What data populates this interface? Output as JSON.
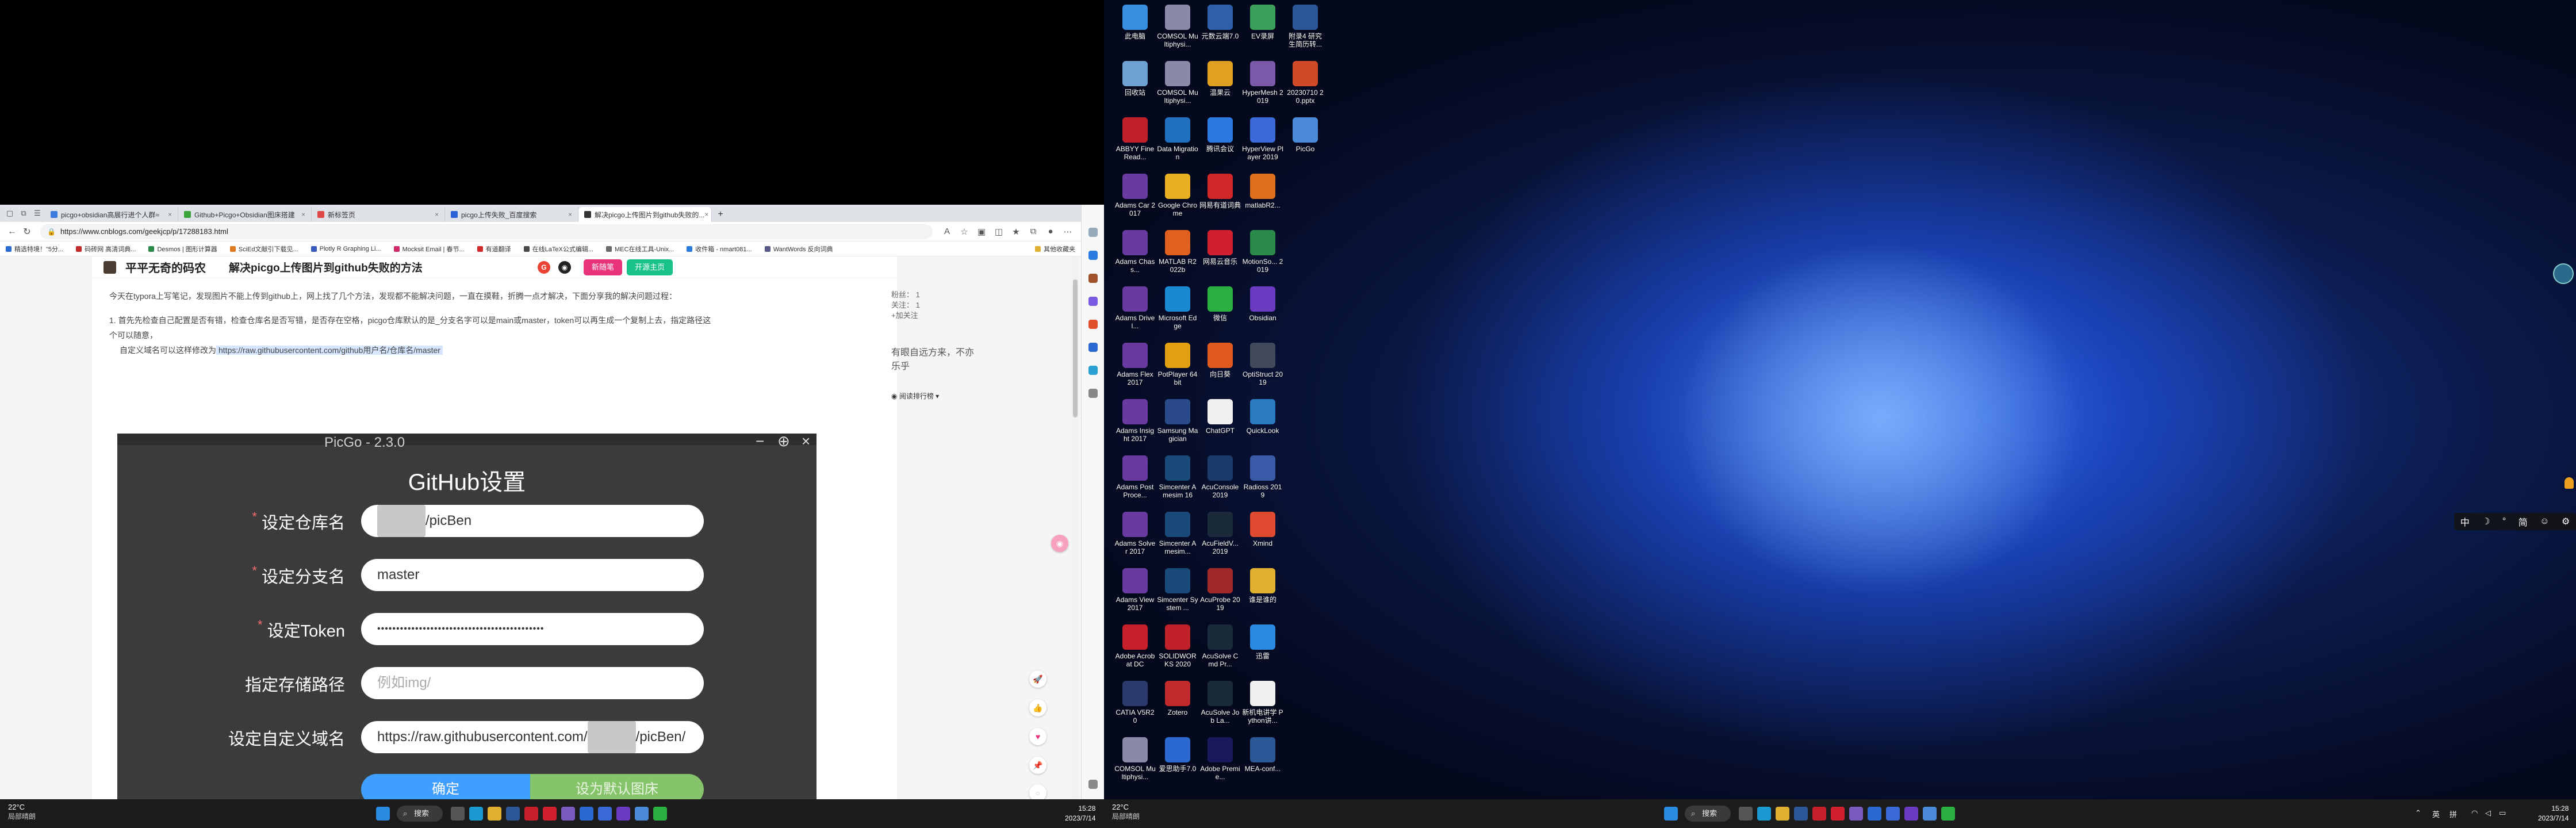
{
  "browser": {
    "tabs": [
      {
        "title": "picgo+obsidian高展行进个人群≈",
        "color": "#3a7be0"
      },
      {
        "title": "Github+Picgo+Obsidian图床搭建",
        "color": "#3aa33a"
      },
      {
        "title": "新标签页",
        "color": "#e04848"
      },
      {
        "title": "picgo上传失败_百度搜索",
        "color": "#2c62d8"
      },
      {
        "title": "解决picgo上传图片到github失败的...",
        "color": "#333333"
      }
    ],
    "new_tab": "+",
    "url": "https://www.cnblogs.com/geekjcp/p/17288183.html",
    "bookmarks": [
      "精选特境！\"5分...",
      "码砖网 高清词典...",
      "Desmos | 图形计算器",
      "SciEd文献引下载见...",
      "Plotly R Graphing Li...",
      "Mocksit Email | 春节...",
      "有道翻译",
      "在线LaTeX公式编辑...",
      "MEC在线工具-Unix...",
      "收件箱 - nmart081...",
      "WantWords 反向词典"
    ],
    "bookmarks_folder": "其他收藏夹"
  },
  "blog": {
    "name": "平平无奇的码农",
    "post_title": "解决picgo上传图片到github失败的方法",
    "btn_new": "新随笔",
    "btn_home": "开源主页",
    "intro": "今天在typora上写笔记，发现图片不能上传到github上，网上找了几个方法，发现都不能解决问题，一直在摸鞋，折腾一点才解决，下面分享我的解决问题过程：",
    "item1": "1. 首先先检查自己配置是否有错，检查仓库名是否写错，是否存在空格，picgo仓库默认的是_分支名字可以是main或master，token可以再生成一个复制上去，指定路径这个可以随意，",
    "item1b": "自定义域名可以这样修改为",
    "link": "https://raw.githubusercontent.com/github用户名/仓库名/master",
    "side_stats": [
      "粉丝： 1",
      "关注： 1",
      "+加关注"
    ],
    "motto": "有眼自远方来，不亦乐乎",
    "reading_rank": "阅读排行榜"
  },
  "picgo": {
    "title": "PicGo - 2.3.0",
    "heading": "GitHub设置",
    "fields": [
      {
        "label": "设定仓库名",
        "required": true,
        "value": "/picBen",
        "blurred": "xxxxxxx",
        "placeholder": ""
      },
      {
        "label": "设定分支名",
        "required": true,
        "value": "master",
        "blurred": "",
        "placeholder": ""
      },
      {
        "label": "设定Token",
        "required": true,
        "value": "••••••••••••••••••••••••••••••••••••••••••••",
        "blurred": "",
        "placeholder": ""
      },
      {
        "label": "指定存储路径",
        "required": false,
        "value": "",
        "blurred": "",
        "placeholder": "例如img/"
      },
      {
        "label": "设定自定义域名",
        "required": false,
        "value": "https://raw.githubusercontent.com/",
        "blurred": "xxxxxxx",
        "value2": "/picBen/",
        "placeholder": ""
      }
    ],
    "ok": "确定",
    "default": "设为默认图床"
  },
  "taskbar_left": {
    "temp": "22°C",
    "weather": "局部晴朗",
    "search": "搜索",
    "time": "15:28",
    "date": "2023/7/14"
  },
  "taskbar_right": {
    "temp": "22°C",
    "weather": "局部晴朗",
    "search": "搜索",
    "time": "15:28",
    "date": "2023/7/14",
    "ime": "英",
    "lang": "拼"
  },
  "ime_bar": [
    "中",
    "☽",
    "°",
    "简",
    "☺",
    "⚙"
  ],
  "desktop": {
    "icons": [
      {
        "label": "此电脑",
        "color": "#3a8ee0"
      },
      {
        "label": "COMSOL Multiphysi...",
        "color": "#8a8aa8"
      },
      {
        "label": "元数云端7.0",
        "color": "#2e5fa8"
      },
      {
        "label": "EV录屏",
        "color": "#3aa05a"
      },
      {
        "label": "附录4 研究 生简历转...",
        "color": "#2b5797"
      },
      {
        "label": "回收站",
        "color": "#6ea0d0"
      },
      {
        "label": "COMSOL Multiphysi...",
        "color": "#8a8aa8"
      },
      {
        "label": "温果云",
        "color": "#e0a020"
      },
      {
        "label": "HyperMesh 2019",
        "color": "#7a5aa8"
      },
      {
        "label": "20230710 2 0.pptx",
        "color": "#d04a2a"
      },
      {
        "label": "ABBYY FineRead...",
        "color": "#c0202a"
      },
      {
        "label": "Data Migration",
        "color": "#2070c0"
      },
      {
        "label": "腾讯会议",
        "color": "#2a7ae0"
      },
      {
        "label": "HyperView Player 2019",
        "color": "#3a6ad8"
      },
      {
        "label": "PicGo",
        "color": "#4a8ad8"
      },
      {
        "label": "Adams Car 2017",
        "color": "#6a3aa0"
      },
      {
        "label": "Google Chrome",
        "color": "#e8b020"
      },
      {
        "label": "网易有道词典",
        "color": "#d02828"
      },
      {
        "label": "matlabR2...",
        "color": "#e07020"
      },
      {
        "label": "",
        "color": "transparent"
      },
      {
        "label": "Adams Chass...",
        "color": "#6a3aa0"
      },
      {
        "label": "MATLAB R2022b",
        "color": "#e06020"
      },
      {
        "label": "网易云音乐",
        "color": "#d02030"
      },
      {
        "label": "MotionSo... 2019",
        "color": "#2a8a4a"
      },
      {
        "label": "",
        "color": "transparent"
      },
      {
        "label": "Adams Drivel...",
        "color": "#6a3aa0"
      },
      {
        "label": "Microsoft Edge",
        "color": "#1a8ad0"
      },
      {
        "label": "微信",
        "color": "#2ab040"
      },
      {
        "label": "Obsidian",
        "color": "#6a3ac0"
      },
      {
        "label": "",
        "color": "transparent"
      },
      {
        "label": "Adams Flex 2017",
        "color": "#6a3aa0"
      },
      {
        "label": "PotPlayer 64 bit",
        "color": "#e0a010"
      },
      {
        "label": "向日葵",
        "color": "#e05a20"
      },
      {
        "label": "OptiStruct 2019",
        "color": "#404a5a"
      },
      {
        "label": "",
        "color": "transparent"
      },
      {
        "label": "Adams Insight 2017",
        "color": "#6a3aa0"
      },
      {
        "label": "Samsung Magician",
        "color": "#2a4a8a"
      },
      {
        "label": "ChatGPT",
        "color": "#f0f0f0"
      },
      {
        "label": "QuickLook",
        "color": "#2a7ac0"
      },
      {
        "label": "",
        "color": "transparent"
      },
      {
        "label": "Adams PostProce...",
        "color": "#6a3aa0"
      },
      {
        "label": "Simcenter Amesim 16",
        "color": "#1a4a7a"
      },
      {
        "label": "AcuConsole 2019",
        "color": "#1a3a6a"
      },
      {
        "label": "Radioss 2019",
        "color": "#3a5aa8"
      },
      {
        "label": "",
        "color": "transparent"
      },
      {
        "label": "Adams Solver 2017",
        "color": "#6a3aa0"
      },
      {
        "label": "Simcenter Amesim...",
        "color": "#1a4a7a"
      },
      {
        "label": "AcuFieldV... 2019",
        "color": "#1a2a3a"
      },
      {
        "label": "Xmind",
        "color": "#e04a30"
      },
      {
        "label": "",
        "color": "transparent"
      },
      {
        "label": "Adams View 2017",
        "color": "#6a3aa0"
      },
      {
        "label": "Simcenter System ...",
        "color": "#1a4a7a"
      },
      {
        "label": "AcuProbe 2019",
        "color": "#a02a2a"
      },
      {
        "label": "谁是谁的",
        "color": "#e0b030"
      },
      {
        "label": "",
        "color": "transparent"
      },
      {
        "label": "Adobe Acrobat DC",
        "color": "#c8202a"
      },
      {
        "label": "SOLIDWORKS 2020",
        "color": "#c02028"
      },
      {
        "label": "AcuSolve Cmd Pr...",
        "color": "#1a2a3a"
      },
      {
        "label": "迅雷",
        "color": "#2a8ae0"
      },
      {
        "label": "",
        "color": "transparent"
      },
      {
        "label": "CATIA V5R20",
        "color": "#2a3a6a"
      },
      {
        "label": "Zotero",
        "color": "#c02a2a"
      },
      {
        "label": "AcuSolve Job La...",
        "color": "#1a2a3a"
      },
      {
        "label": "新机电讲学 Python讲...",
        "color": "#f0f0f0"
      },
      {
        "label": "",
        "color": "transparent"
      },
      {
        "label": "COMSOL Multiphysi...",
        "color": "#8a8aa8"
      },
      {
        "label": "爱思助手7.0",
        "color": "#2a6ad0"
      },
      {
        "label": "Adobe Premie...",
        "color": "#1a1a5a"
      },
      {
        "label": "MEA-conf...",
        "color": "#2b5797"
      }
    ]
  }
}
